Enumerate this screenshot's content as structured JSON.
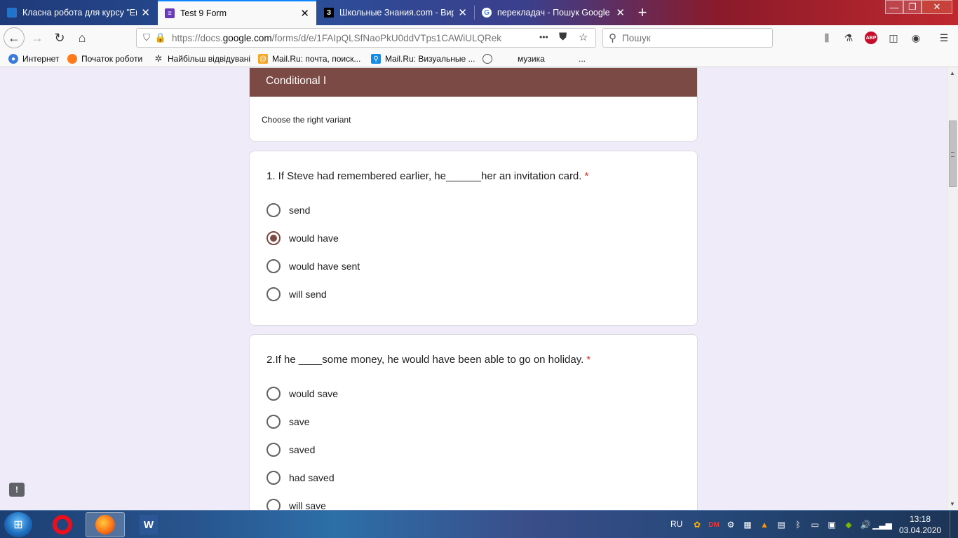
{
  "browser": {
    "tabs": [
      {
        "title": "Класна робота для курсу \"Eng",
        "favicon": "classroom-icon",
        "active": false
      },
      {
        "title": "Test 9 Form",
        "favicon": "google-forms-icon",
        "active": true
      },
      {
        "title": "Школьные Знания.com - Вир",
        "favicon": "znanija-icon",
        "active": false
      },
      {
        "title": "перекладач - Пошук Google",
        "favicon": "google-icon",
        "active": false
      }
    ],
    "url_prefix": "https://docs.",
    "url_domain": "google.com",
    "url_rest": "/forms/d/e/1FAIpQLSfNaoPkU0ddVTps1CAWiULQRek",
    "url_more": "•••",
    "search_placeholder": "Пошук",
    "bookmarks": [
      {
        "label": "Интернет",
        "icon": "globe-icon"
      },
      {
        "label": "Початок роботи",
        "icon": "firefox-icon"
      },
      {
        "label": "Найбільш відвідувані",
        "icon": "gear-icon"
      },
      {
        "label": "Mail.Ru: почта, поиск...",
        "icon": "mailru-icon"
      },
      {
        "label": "Mail.Ru: Визуальные ...",
        "icon": "mailru-search-icon"
      },
      {
        "label": "",
        "icon": "globe-icon"
      },
      {
        "label": "музика",
        "icon": "none"
      },
      {
        "label": "...",
        "icon": "none"
      }
    ]
  },
  "form": {
    "title": "Conditional I",
    "description": "Choose the right variant",
    "accent_color": "#7b4a44",
    "questions": [
      {
        "text": "1. If Steve had remembered earlier, he______her an invitation card.",
        "required_mark": "*",
        "options": [
          {
            "label": "send",
            "selected": false
          },
          {
            "label": "would have",
            "selected": true
          },
          {
            "label": "would have sent",
            "selected": false
          },
          {
            "label": "will send",
            "selected": false
          }
        ]
      },
      {
        "text": "2.If he ____some money, he would have been able to go on holiday.",
        "required_mark": "*",
        "options": [
          {
            "label": "would save",
            "selected": false
          },
          {
            "label": "save",
            "selected": false
          },
          {
            "label": "saved",
            "selected": false
          },
          {
            "label": "had saved",
            "selected": false
          },
          {
            "label": "will save",
            "selected": false
          }
        ]
      }
    ],
    "feedback_icon": "!"
  },
  "taskbar": {
    "apps": [
      {
        "name": "opera-icon",
        "active": false
      },
      {
        "name": "firefox-icon",
        "active": true
      },
      {
        "name": "word-icon",
        "active": false
      }
    ],
    "language": "RU",
    "time": "13:18",
    "date": "03.04.2020"
  }
}
